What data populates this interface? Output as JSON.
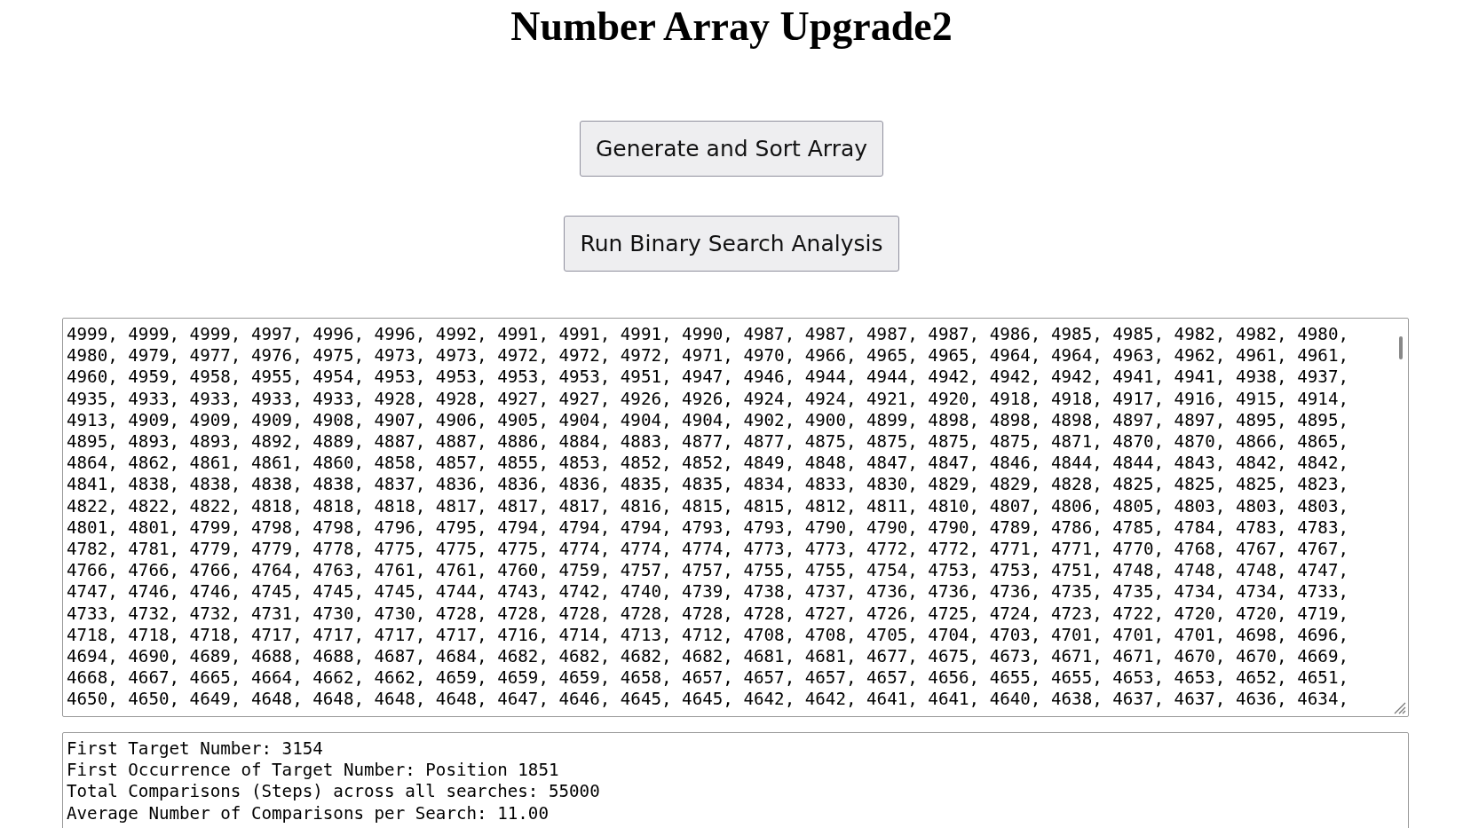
{
  "title": "Number Array Upgrade2",
  "buttons": [
    "Generate and Sort Array",
    "Run Binary Search Analysis"
  ],
  "array_lines": [
    "4999, 4999, 4999, 4997, 4996, 4996, 4992, 4991, 4991, 4991, 4990, 4987, 4987, 4987, 4987, 4986, 4985, 4985, 4982, 4982, 4980,",
    "4980, 4979, 4977, 4976, 4975, 4973, 4973, 4972, 4972, 4972, 4971, 4970, 4966, 4965, 4965, 4964, 4964, 4963, 4962, 4961, 4961,",
    "4960, 4959, 4958, 4955, 4954, 4953, 4953, 4953, 4953, 4951, 4947, 4946, 4944, 4944, 4942, 4942, 4942, 4941, 4941, 4938, 4937,",
    "4935, 4933, 4933, 4933, 4933, 4928, 4928, 4927, 4927, 4926, 4926, 4924, 4924, 4921, 4920, 4918, 4918, 4917, 4916, 4915, 4914,",
    "4913, 4909, 4909, 4909, 4908, 4907, 4906, 4905, 4904, 4904, 4904, 4902, 4900, 4899, 4898, 4898, 4898, 4897, 4897, 4895, 4895,",
    "4895, 4893, 4893, 4892, 4889, 4887, 4887, 4886, 4884, 4883, 4877, 4877, 4875, 4875, 4875, 4875, 4871, 4870, 4870, 4866, 4865,",
    "4864, 4862, 4861, 4861, 4860, 4858, 4857, 4855, 4853, 4852, 4852, 4849, 4848, 4847, 4847, 4846, 4844, 4844, 4843, 4842, 4842,",
    "4841, 4838, 4838, 4838, 4838, 4837, 4836, 4836, 4836, 4835, 4835, 4834, 4833, 4830, 4829, 4829, 4828, 4825, 4825, 4825, 4823,",
    "4822, 4822, 4822, 4818, 4818, 4818, 4817, 4817, 4817, 4816, 4815, 4815, 4812, 4811, 4810, 4807, 4806, 4805, 4803, 4803, 4803,",
    "4801, 4801, 4799, 4798, 4798, 4796, 4795, 4794, 4794, 4794, 4793, 4793, 4790, 4790, 4790, 4789, 4786, 4785, 4784, 4783, 4783,",
    "4782, 4781, 4779, 4779, 4778, 4775, 4775, 4775, 4774, 4774, 4774, 4773, 4773, 4772, 4772, 4771, 4771, 4770, 4768, 4767, 4767,",
    "4766, 4766, 4766, 4764, 4763, 4761, 4761, 4760, 4759, 4757, 4757, 4755, 4755, 4754, 4753, 4753, 4751, 4748, 4748, 4748, 4747,",
    "4747, 4746, 4746, 4745, 4745, 4745, 4744, 4743, 4742, 4740, 4739, 4738, 4737, 4736, 4736, 4736, 4735, 4735, 4734, 4734, 4733,",
    "4733, 4732, 4732, 4731, 4730, 4730, 4728, 4728, 4728, 4728, 4728, 4728, 4727, 4726, 4725, 4724, 4723, 4722, 4720, 4720, 4719,",
    "4718, 4718, 4718, 4717, 4717, 4717, 4717, 4716, 4714, 4713, 4712, 4708, 4708, 4705, 4704, 4703, 4701, 4701, 4701, 4698, 4696,",
    "4694, 4690, 4689, 4688, 4688, 4687, 4684, 4682, 4682, 4682, 4682, 4681, 4681, 4677, 4675, 4673, 4671, 4671, 4670, 4670, 4669,",
    "4668, 4667, 4665, 4664, 4662, 4662, 4659, 4659, 4659, 4658, 4657, 4657, 4657, 4657, 4656, 4655, 4655, 4653, 4653, 4652, 4651,",
    "4650, 4650, 4649, 4648, 4648, 4648, 4648, 4647, 4646, 4645, 4645, 4642, 4642, 4641, 4641, 4640, 4638, 4637, 4637, 4636, 4634,"
  ],
  "results": [
    "First Target Number: 3154",
    "First Occurrence of Target Number: Position 1851",
    "Total Comparisons (Steps) across all searches: 55000",
    "Average Number of Comparisons per Search: 11.00"
  ]
}
